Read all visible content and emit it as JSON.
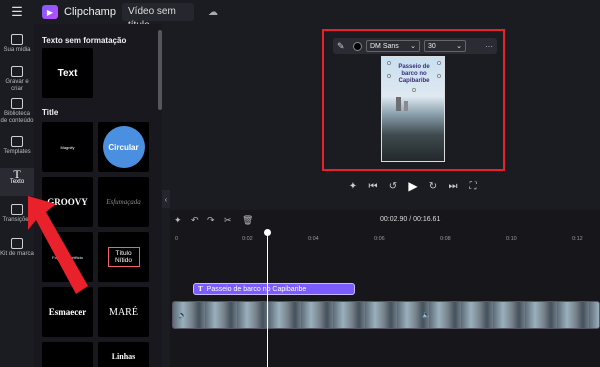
{
  "topbar": {
    "brand": "Clipchamp",
    "video_title": "Vídeo sem título"
  },
  "nav": [
    {
      "label": "Sua mídia"
    },
    {
      "label": "Gravar e criar"
    },
    {
      "label": "Biblioteca de conteúdo"
    },
    {
      "label": "Templates"
    },
    {
      "label": "Texto"
    },
    {
      "label": "Transições"
    },
    {
      "label": "Kit de marca"
    }
  ],
  "panel": {
    "section1": "Texto sem formatação",
    "plain_tile": "Text",
    "section2": "Title",
    "tiles": [
      "Magnify",
      "Circular",
      "GROOVY",
      "Esfumaçada",
      "Fogos de artifício",
      "Título Nítido",
      "Esmaecer",
      "MARÉ",
      "Linhas"
    ]
  },
  "toolbar": {
    "font": "DM Sans",
    "size": "30"
  },
  "preview_text": "Passeio de barco no Capibaribe",
  "timeline": {
    "time": "00:02.90 / 00:16.61",
    "ticks": [
      "0",
      "0:02",
      "0:04",
      "0:06",
      "0:08",
      "0:10",
      "0:12"
    ],
    "text_clip": "Passeio de barco no Capibaribe"
  },
  "colors": {
    "accent": "#7b5cff",
    "highlight": "#e8212b"
  }
}
